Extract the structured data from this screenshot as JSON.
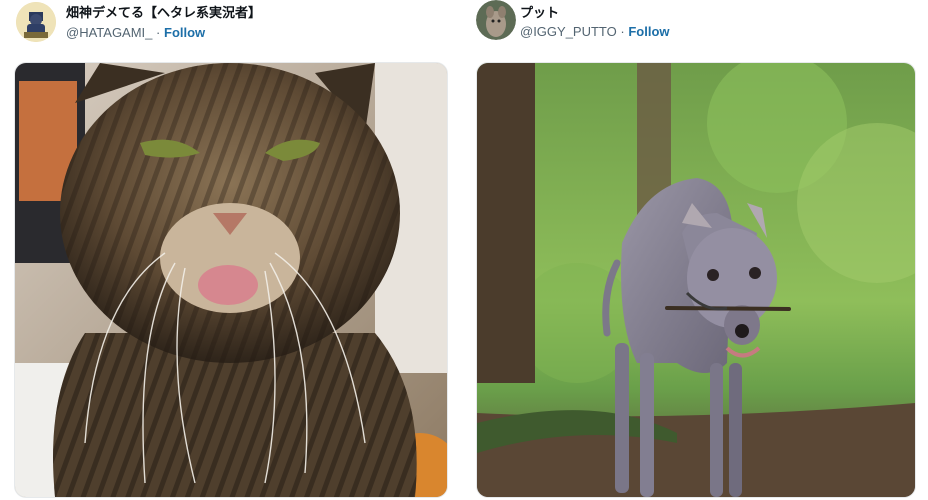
{
  "tweets": [
    {
      "display_name": "畑神デメてる【ヘタレ系実況者】",
      "handle": "@HATAGAMI_",
      "separator": "·",
      "follow_label": "Follow",
      "media_subject": "tabby-cat-tongue-out-photo"
    },
    {
      "display_name": "プット",
      "handle": "@IGGY_PUTTO",
      "separator": "·",
      "follow_label": "Follow",
      "media_subject": "italian-greyhound-with-stick-in-forest-photo"
    }
  ],
  "colors": {
    "link": "#1d6fa8",
    "muted": "#536471",
    "text": "#0f1419"
  }
}
